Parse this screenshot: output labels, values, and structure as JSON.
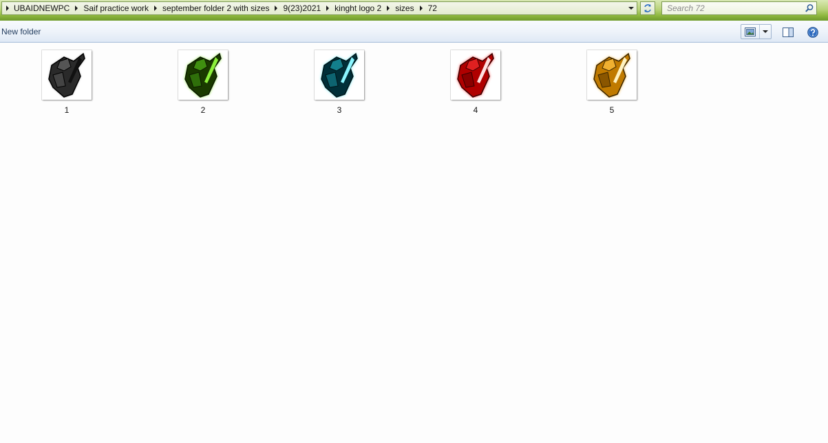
{
  "address_bar": {
    "breadcrumbs": [
      "UBAIDNEWPC",
      "Saif practice work",
      "september folder 2 with sizes",
      "9(23)2021",
      "kinght logo 2",
      "sizes",
      "72"
    ]
  },
  "search": {
    "placeholder": "Search 72"
  },
  "toolbar": {
    "new_folder_label": "New folder"
  },
  "files": [
    {
      "name": "1",
      "icon": "knight-logo-black-thumbnail",
      "accent": "#2b2b2b",
      "glow": "#6a6a6a"
    },
    {
      "name": "2",
      "icon": "knight-logo-green-thumbnail",
      "accent": "#1a3a00",
      "glow": "#6fe01a"
    },
    {
      "name": "3",
      "icon": "knight-logo-cyan-thumbnail",
      "accent": "#002f38",
      "glow": "#3fe6f0"
    },
    {
      "name": "4",
      "icon": "knight-logo-red-thumbnail",
      "accent": "#3a0000",
      "glow": "#ff2020"
    },
    {
      "name": "5",
      "icon": "knight-logo-gold-thumbnail",
      "accent": "#3a2500",
      "glow": "#f0a41a"
    }
  ],
  "colors": {
    "frame_green": "#8fb83f",
    "toolbar_blue": "#dfe9f5",
    "link_text": "#1e395b"
  }
}
